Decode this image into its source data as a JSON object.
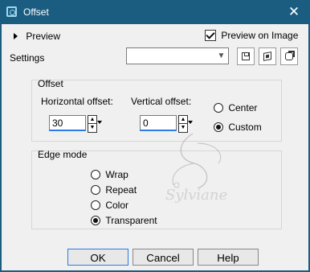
{
  "titlebar": {
    "title": "Offset",
    "close_glyph": "✕"
  },
  "preview": {
    "label": "Preview",
    "preview_on_image_label": "Preview on Image",
    "preview_on_image_checked": true
  },
  "settings": {
    "label": "Settings",
    "value": ""
  },
  "offset_group": {
    "title": "Offset",
    "horizontal_label": "Horizontal offset:",
    "horizontal_value": "30",
    "vertical_label": "Vertical offset:",
    "vertical_value": "0",
    "center_label": "Center",
    "custom_label": "Custom",
    "selected": "Custom"
  },
  "edge_mode": {
    "title": "Edge mode",
    "options": [
      "Wrap",
      "Repeat",
      "Color",
      "Transparent"
    ],
    "selected": "Transparent"
  },
  "watermark": {
    "text": "Sylviane"
  },
  "buttons": {
    "ok": "OK",
    "cancel": "Cancel",
    "help": "Help"
  },
  "icons": {
    "titlebar": "offset-app-icon",
    "toolbar": [
      "save-preset-icon",
      "randomize-icon",
      "reset-icon"
    ],
    "dropdown": "chevron-down-icon"
  },
  "colors": {
    "titlebar": "#1a5d80",
    "focus_accent": "#2c7be5"
  }
}
